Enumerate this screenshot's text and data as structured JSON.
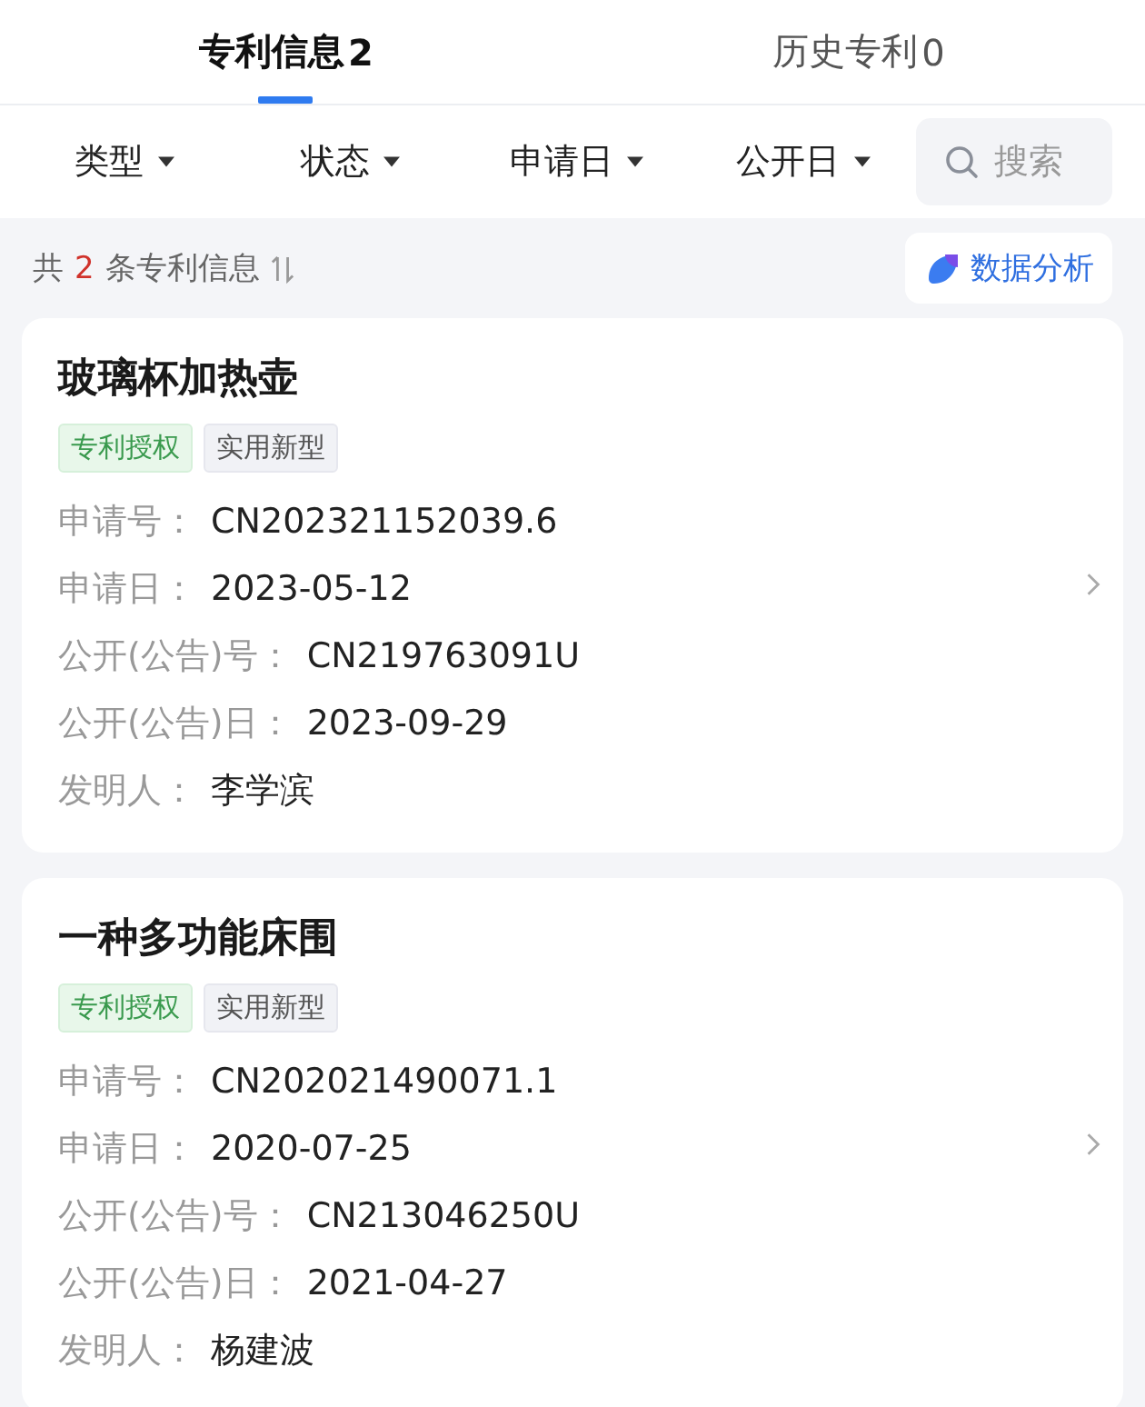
{
  "tabs": [
    {
      "label": "专利信息",
      "count": "2",
      "selected": true
    },
    {
      "label": "历史专利",
      "count": "0",
      "selected": false
    }
  ],
  "filters": [
    "类型",
    "状态",
    "申请日",
    "公开日"
  ],
  "search": {
    "placeholder": "搜索"
  },
  "summary": {
    "prefix": "共",
    "count": "2",
    "suffix": "条专利信息"
  },
  "analysis_button": "数据分析",
  "patents": [
    {
      "title": "玻璃杯加热壶",
      "tags": [
        {
          "label": "专利授权",
          "kind": "status"
        },
        {
          "label": "实用新型",
          "kind": "type"
        }
      ],
      "fields": [
        {
          "label": "申请号：",
          "value": "CN202321152039.6"
        },
        {
          "label": "申请日：",
          "value": "2023-05-12"
        },
        {
          "label": "公开(公告)号：",
          "value": "CN219763091U"
        },
        {
          "label": "公开(公告)日：",
          "value": "2023-09-29"
        },
        {
          "label": "发明人：",
          "value": "李学滨"
        }
      ]
    },
    {
      "title": "一种多功能床围",
      "tags": [
        {
          "label": "专利授权",
          "kind": "status"
        },
        {
          "label": "实用新型",
          "kind": "type"
        }
      ],
      "fields": [
        {
          "label": "申请号：",
          "value": "CN202021490071.1"
        },
        {
          "label": "申请日：",
          "value": "2020-07-25"
        },
        {
          "label": "公开(公告)号：",
          "value": "CN213046250U"
        },
        {
          "label": "公开(公告)日：",
          "value": "2021-04-27"
        },
        {
          "label": "发明人：",
          "value": "杨建波"
        }
      ]
    }
  ]
}
